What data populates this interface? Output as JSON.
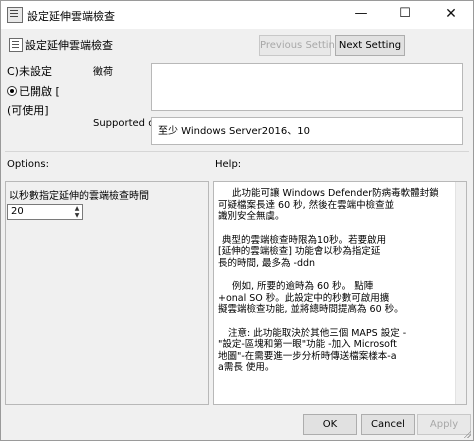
{
  "window": {
    "title": "設定延伸雲端檢查",
    "controls": {
      "minimize": "—",
      "maximize": "☐",
      "close": "✕"
    }
  },
  "header": {
    "title": "設定延伸雲端檢查",
    "prev_button": "Previous Setting",
    "next_button": "Next Setting"
  },
  "state": {
    "options": [
      {
        "label": "未設定",
        "prefix": "C)"
      },
      {
        "label": "已開啟 [",
        "prefix": ""
      },
      {
        "label": "可使用]",
        "prefix": "("
      }
    ],
    "selected_index": 1
  },
  "comment": {
    "label": "徵荷"
  },
  "supported": {
    "label": "Supported on:",
    "value": "至少 Windows Server2016、10"
  },
  "options_section": {
    "label": "Options:",
    "field_label": "以秒數指定延伸的雲端檢查時間",
    "value": "20"
  },
  "help_section": {
    "label": "Help:",
    "paragraphs": [
      [
        "此功能可讓 Windows Defender防病毒軟體封鎖",
        "可疑檔案長達 60 秒, 然後在雲端中檢查並",
        "識別安全無虞。"
      ],
      [
        "典型的雲端檢查時限為10秒。若要啟用",
        "[延伸的雲端檢查] 功能會以秒為指定延",
        "長的時間, 最多為 -ddn"
      ],
      [
        "例如, 所要的逾時為 60 秒。 點陣",
        "+onal SO 秒。此設定中的秒數可啟用擴",
        "擬雲端檢查功能, 並將總時間提高為 60 秒。"
      ],
      [
        "注意: 此功能取決於其他三個 MAPS 設定 -",
        "\"設定-區塊和第一眼\"功能 -加入 Microsoft",
        "地圖\"-在需要進一步分析時傳送檔案樣本-a",
        "a需長 使用。"
      ]
    ]
  },
  "footer": {
    "ok": "OK",
    "cancel": "Cancel",
    "apply": "Apply"
  }
}
